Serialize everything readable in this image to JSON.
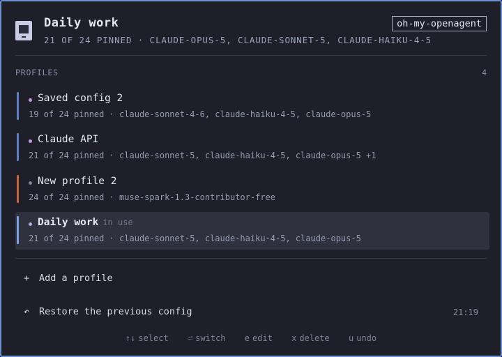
{
  "header": {
    "title": "Daily work",
    "subtitle": "21 OF 24 PINNED · CLAUDE-OPUS-5, CLAUDE-SONNET-5, CLAUDE-HAIKU-4-5",
    "brand": "oh-my-openagent",
    "icon": "terminal-window-icon"
  },
  "profiles_section": {
    "label": "PROFILES",
    "count": "4"
  },
  "profiles": [
    {
      "name": "Saved config 2",
      "detail": "19 of 24 pinned · claude-sonnet-4-6, claude-haiku-4-5, claude-opus-5",
      "bar_color": "#5e7fc4",
      "dot_color": "#c29ae0",
      "active": false,
      "status": ""
    },
    {
      "name": "Claude API",
      "detail": "21 of 24 pinned · claude-sonnet-5, claude-haiku-4-5, claude-opus-5 +1",
      "bar_color": "#5e7fc4",
      "dot_color": "#c29ae0",
      "active": false,
      "status": ""
    },
    {
      "name": "New profile 2",
      "detail": "24 of 24 pinned · muse-spark-1.3-contributor-free",
      "bar_color": "#c7663d",
      "dot_color": "#7e8499",
      "active": false,
      "status": ""
    },
    {
      "name": "Daily work",
      "detail": "21 of 24 pinned · claude-sonnet-5, claude-haiku-4-5, claude-opus-5",
      "bar_color": "#7ba1e6",
      "dot_color": "#b9a5d8",
      "active": true,
      "status": "in use"
    }
  ],
  "actions": {
    "add": {
      "icon": "plus-icon",
      "glyph": "+",
      "label": "Add a profile"
    },
    "restore": {
      "icon": "undo-arrow-icon",
      "glyph": "↶",
      "label": "Restore the previous config",
      "time": "21:19"
    }
  },
  "hints": [
    {
      "key": "↑↓",
      "label": "select"
    },
    {
      "key": "⏎",
      "label": "switch"
    },
    {
      "key": "e",
      "label": "edit"
    },
    {
      "key": "x",
      "label": "delete"
    },
    {
      "key": "u",
      "label": "undo"
    }
  ]
}
